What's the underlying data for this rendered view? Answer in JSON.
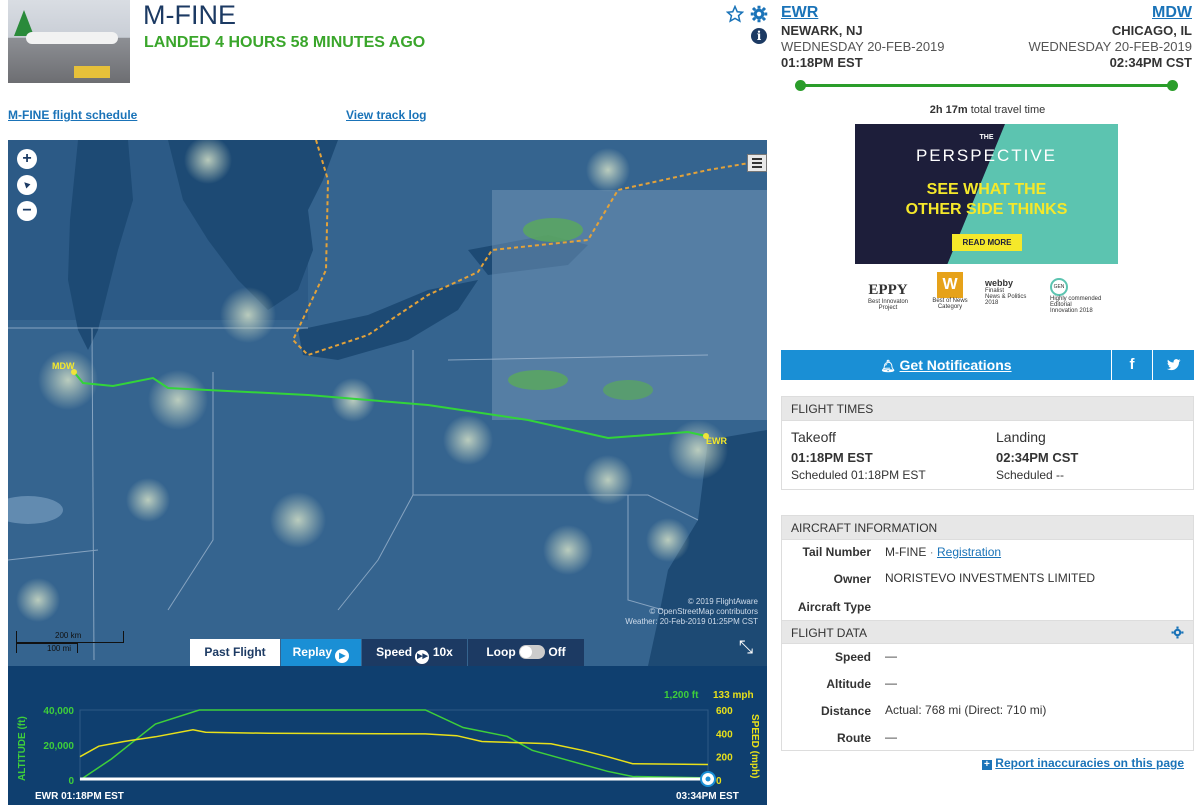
{
  "flight": {
    "ident": "M-FINE",
    "status": "LANDED 4 HOURS 58 MINUTES AGO",
    "schedule_link": "M-FINE flight schedule",
    "track_link": "View track log",
    "star_icon": "star-icon",
    "gear_icon": "gear-icon",
    "info_icon": "i"
  },
  "route": {
    "origin": {
      "code": "EWR",
      "city": "NEWARK, NJ",
      "date": "WEDNESDAY 20-FEB-2019",
      "time": "01:18PM EST"
    },
    "destination": {
      "code": "MDW",
      "city": "CHICAGO, IL",
      "date": "WEDNESDAY 20-FEB-2019",
      "time": "02:34PM CST"
    },
    "travel_time_value": "2h 17m",
    "travel_time_suffix": "total travel time"
  },
  "ad": {
    "brand_top": "THE",
    "brand": "PERSPECTIVE",
    "headline_line1": "SEE WHAT THE",
    "headline_line2": "OTHER SIDE THINKS",
    "cta": "READ MORE",
    "awards": [
      {
        "name": "EPPY",
        "line1": "Best Innovaton",
        "line2": "Project"
      },
      {
        "name": "W",
        "line1": "Best of News",
        "line2": "Category"
      },
      {
        "name": "webby",
        "line1": "Finalist",
        "line2": "News & Politics",
        "line3": "2018"
      },
      {
        "name": "GEN",
        "line1": "Highly commended",
        "line2": "Editorial",
        "line3": "Innovation 2018"
      }
    ]
  },
  "notify": {
    "label": "Get Notifications",
    "facebook": "f",
    "twitter": "twitter-icon"
  },
  "flight_times": {
    "header": "FLIGHT TIMES",
    "takeoff_label": "Takeoff",
    "takeoff_time": "01:18PM EST",
    "takeoff_sched": "Scheduled 01:18PM EST",
    "landing_label": "Landing",
    "landing_time": "02:34PM CST",
    "landing_sched": "Scheduled --"
  },
  "aircraft": {
    "header": "AIRCRAFT INFORMATION",
    "tail_label": "Tail Number",
    "tail_value": "M-FINE",
    "tail_sep": "·",
    "registration": "Registration",
    "owner_label": "Owner",
    "owner_value": "NORISTEVO INVESTMENTS LIMITED",
    "type_label": "Aircraft Type"
  },
  "flight_data": {
    "header": "FLIGHT DATA",
    "speed_label": "Speed",
    "speed_value": "—",
    "altitude_label": "Altitude",
    "altitude_value": "—",
    "distance_label": "Distance",
    "distance_value": "Actual: 768 mi (Direct: 710 mi)",
    "route_label": "Route",
    "route_value": "—"
  },
  "report_link": "Report inaccuracies on this page",
  "map": {
    "zoom_in": "+",
    "zoom_out": "−",
    "compass": "▲",
    "label_mdw": "MDW",
    "label_ewr": "EWR",
    "scale_km": "200 km",
    "scale_mi": "100 mi",
    "credit1": "© 2019 FlightAware",
    "credit2": "© OpenStreetMap contributors",
    "credit3": "Weather: 20-Feb-2019 01:25PM CST",
    "collapse_icon": "collapse-icon"
  },
  "toolbar": {
    "past": "Past Flight",
    "replay": "Replay",
    "speed": "Speed",
    "speed_value": "10x",
    "loop": "Loop",
    "loop_state": "Off"
  },
  "chart_data": {
    "type": "line",
    "xlabel_start": "EWR 01:18PM EST",
    "xlabel_end": "03:34PM EST",
    "ylabel_left": "ALTITUDE (ft)",
    "ylabel_right": "SPEED (mph)",
    "left_ticks": [
      "40,000",
      "20,000",
      "0"
    ],
    "right_ticks": [
      "600",
      "400",
      "200",
      "0"
    ],
    "current_altitude": "1,200 ft",
    "current_speed": "133 mph",
    "ylim_altitude": [
      0,
      40000
    ],
    "ylim_speed": [
      0,
      600
    ],
    "series": [
      {
        "name": "Altitude",
        "color": "#3ecf3a",
        "points": [
          [
            0,
            0
          ],
          [
            0.05,
            12000
          ],
          [
            0.12,
            32000
          ],
          [
            0.19,
            40000
          ],
          [
            0.55,
            40000
          ],
          [
            0.61,
            30000
          ],
          [
            0.68,
            25000
          ],
          [
            0.72,
            17000
          ],
          [
            0.78,
            11000
          ],
          [
            0.84,
            5000
          ],
          [
            0.88,
            2000
          ],
          [
            1.0,
            1200
          ]
        ]
      },
      {
        "name": "Speed",
        "color": "#e8e01a",
        "points": [
          [
            0,
            200
          ],
          [
            0.03,
            290
          ],
          [
            0.07,
            330
          ],
          [
            0.12,
            370
          ],
          [
            0.18,
            430
          ],
          [
            0.2,
            410
          ],
          [
            0.3,
            400
          ],
          [
            0.55,
            395
          ],
          [
            0.6,
            380
          ],
          [
            0.64,
            330
          ],
          [
            0.75,
            310
          ],
          [
            0.8,
            255
          ],
          [
            0.84,
            200
          ],
          [
            0.88,
            140
          ],
          [
            1.0,
            133
          ]
        ]
      }
    ]
  }
}
